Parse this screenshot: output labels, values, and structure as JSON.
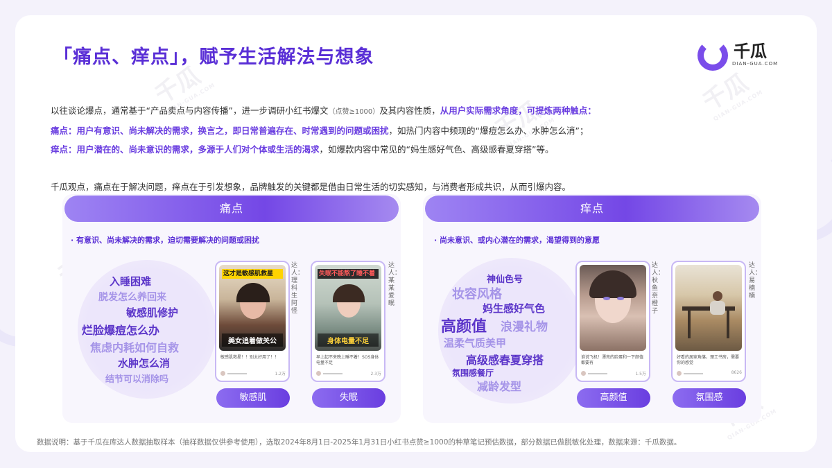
{
  "title": "「痛点、痒点」，赋予生活解法与想象",
  "logo": {
    "name": "千瓜",
    "sub": "DIAN-GUA.COM"
  },
  "watermark": {
    "name": "千瓜",
    "sub": "QIAN-GUA.COM"
  },
  "intro": {
    "line1_a": "以往谈论爆点，通常基于“产品卖点与内容传播”，进一步调研小红书爆文",
    "line1_b": "（点赞≥1000）",
    "line1_c": "及其内容性质，",
    "line1_d": "从用户实际需求角度，可提炼两种触点：",
    "line2_a": "痛点：用户有意识、尚未解决的需求，换言之，即日常普遍存在、时常遇到的问题或困扰",
    "line2_b": "，如热门内容中频现的“爆痘怎么办、水肿怎么消”；",
    "line3_a": "痒点：用户潜在的、尚未意识的需求，多源于人们对个体或生活的渴求",
    "line3_b": "，如爆款内容中常见的“妈生感好气色、高级感春夏穿搭”等。",
    "line4": "千瓜观点，痛点在于解决问题，痒点在于引发想象，品牌触发的关键都是借由日常生活的切实感知，与消费者形成共识，从而引爆内容。"
  },
  "pain": {
    "header": "痛点",
    "subtitle": "· 有意识、尚未解决的需求，迫切需要解决的问题或困扰",
    "keywords": [
      "入睡困难",
      "脱发怎么养回来",
      "敏感肌修护",
      "烂脸爆痘怎么办",
      "焦虑内耗如何自救",
      "水肿怎么消",
      "结节可以消除吗"
    ],
    "cards": [
      {
        "tag": "敏感肌",
        "label": "达人：理科生阿怪",
        "overlay_top": "这才是敏感肌救星",
        "overlay_bottom": "美女追着做关公",
        "caption": "敏感肌救星！！别太好用了！！"
      },
      {
        "tag": "失眠",
        "label": "达人：某某爱眠",
        "overlay_top": "失眠不能熬了睡不着",
        "overlay_bottom": "身体电量不足",
        "caption": "早上起不来晚上睡不着！SOS身体电量不足"
      }
    ]
  },
  "itch": {
    "header": "痒点",
    "subtitle": "· 尚未意识、或内心潜在的需求，渴望得到的意愿",
    "keywords": [
      "神仙色号",
      "妆容风格",
      "妈生感好气色",
      "高颜值",
      "浪漫礼物",
      "温柔气质美甲",
      "高级感春夏穿搭",
      "氛围感餐厅",
      "减龄发型"
    ],
    "cards": [
      {
        "tag": "高颜值",
        "label": "达人：秋鱼奈橙子",
        "caption": "谁说飞机！漂亮的脸蛋和一下颜值都要有"
      },
      {
        "tag": "氛围感",
        "label": "达人：易楠楠",
        "caption": "好看的居家角落，理工书房，需要你的感觉"
      }
    ]
  },
  "card_likes": [
    "1.2万",
    "2.3万",
    "1.5万",
    "8626"
  ],
  "footnote": "数据说明：基于千瓜在库达人数据抽取样本（抽样数据仅供参考使用），选取2024年8月1日-2025年1月31日小红书点赞≥1000的种草笔记预估数据，部分数据已做脱敏化处理，数据来源：千瓜数据。",
  "colors": {
    "accent": "#6a3ee0",
    "title": "#5a2fd6",
    "keyword_dark": "#5b35c9",
    "keyword_light": "#a594e8"
  }
}
